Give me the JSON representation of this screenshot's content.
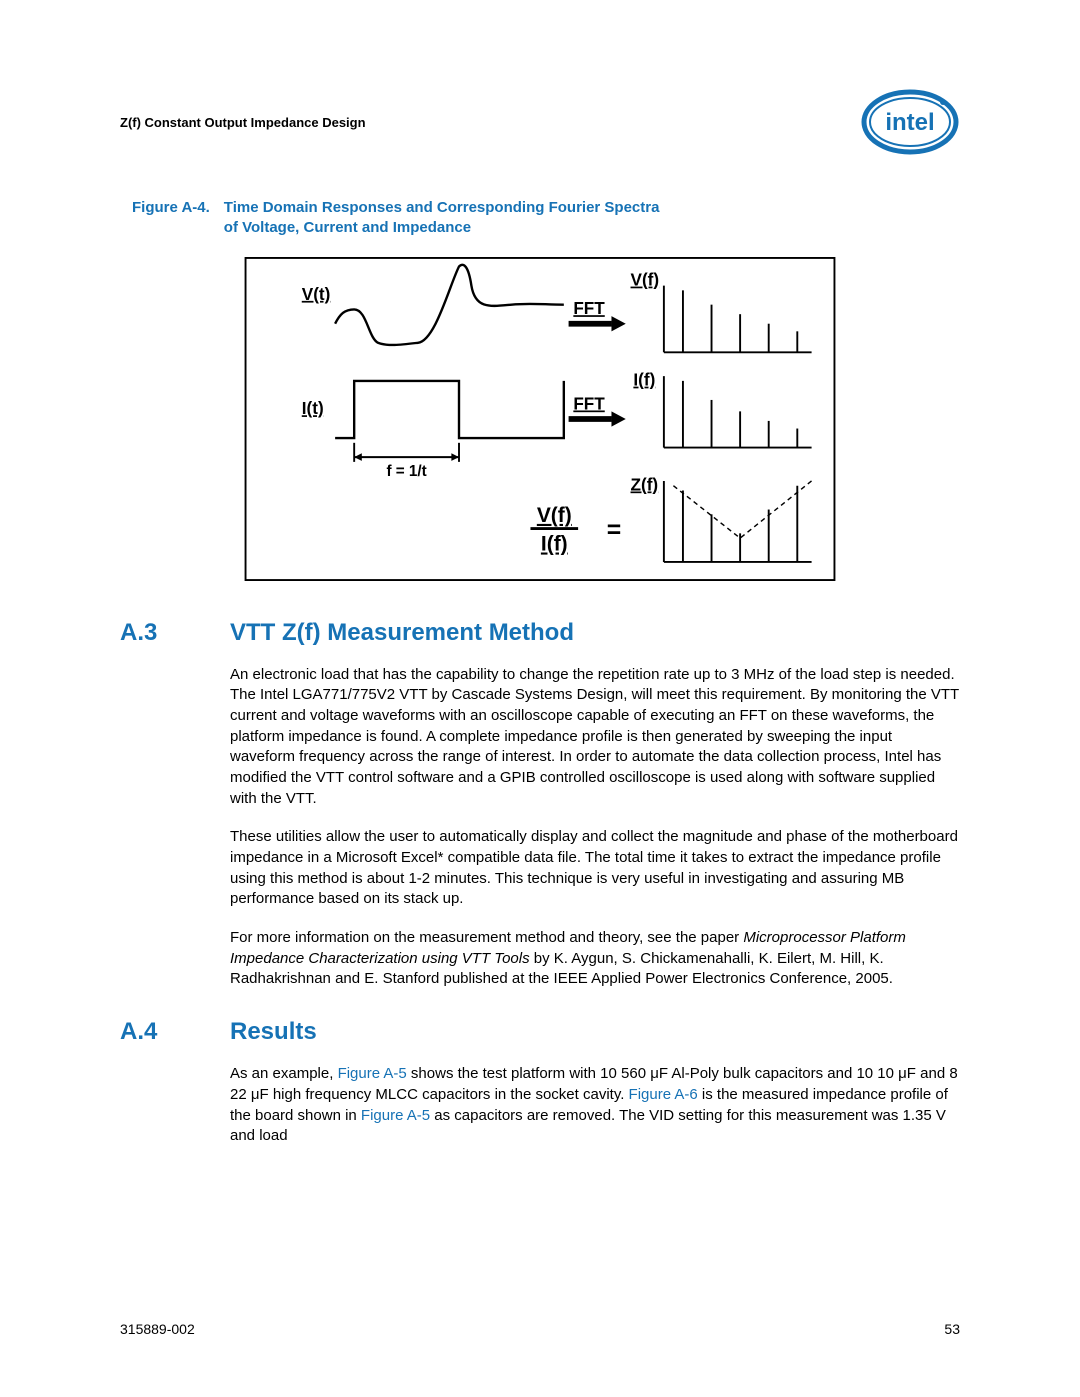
{
  "header": {
    "doc_title": "Z(f) Constant Output Impedance Design"
  },
  "figure": {
    "number": "Figure A-4.",
    "title_line1": "Time Domain Responses and Corresponding Fourier Spectra",
    "title_line2": "of Voltage, Current and Impedance",
    "lbl_Vt": "V(t)",
    "lbl_It": "I(t)",
    "lbl_Vf": "V(f)",
    "lbl_If": "I(f)",
    "lbl_Zf": "Z(f)",
    "lbl_FFT1": "FFT",
    "lbl_FFT2": "FFT",
    "lbl_f1t": "f = 1/t",
    "lbl_ratio_top": "V(f)",
    "lbl_ratio_bot": "I(f)",
    "lbl_eq": "="
  },
  "sections": {
    "A3": {
      "num": "A.3",
      "title": "VTT Z(f) Measurement Method",
      "p1": "An electronic load that has the capability to change the repetition rate up to 3 MHz of the load step is needed. The Intel LGA771/775V2 VTT by Cascade Systems Design, will meet this requirement. By monitoring the VTT current and voltage waveforms with an oscilloscope capable of executing an FFT on these waveforms, the platform impedance is found. A complete impedance profile is then generated by sweeping the input waveform frequency across the range of interest. In order to automate the data collection process, Intel has modified the VTT control software and a GPIB controlled oscilloscope is used along with software supplied with the VTT.",
      "p2": "These utilities allow the user to automatically display and collect the magnitude and phase of the motherboard impedance in a Microsoft Excel* compatible data file. The total time it takes to extract the impedance profile using this method is about 1-2 minutes. This technique is very useful in investigating and assuring MB performance based on its stack up.",
      "p3a": "For more information on the measurement method and theory, see the paper ",
      "p3_italic": "Microprocessor Platform Impedance Characterization using VTT Tools",
      "p3b": " by K. Aygun, S. Chickamenahalli, K. Eilert, M. Hill, K. Radhakrishnan and E. Stanford published at the IEEE Applied Power Electronics Conference, 2005."
    },
    "A4": {
      "num": "A.4",
      "title": "Results",
      "p1a": "As an example, ",
      "link1": "Figure A-5",
      "p1b": " shows the test platform with 10 560 μF Al-Poly bulk capacitors and 10 10 μF and 8 22 μF high frequency MLCC capacitors in the socket cavity. ",
      "link2": "Figure A-6",
      "p1c": " is the measured impedance profile of the board shown in ",
      "link3": "Figure A-5",
      "p1d": " as capacitors are removed. The VID setting for this measurement was 1.35 V and load"
    }
  },
  "footer": {
    "left": "315889-002",
    "right": "53"
  }
}
